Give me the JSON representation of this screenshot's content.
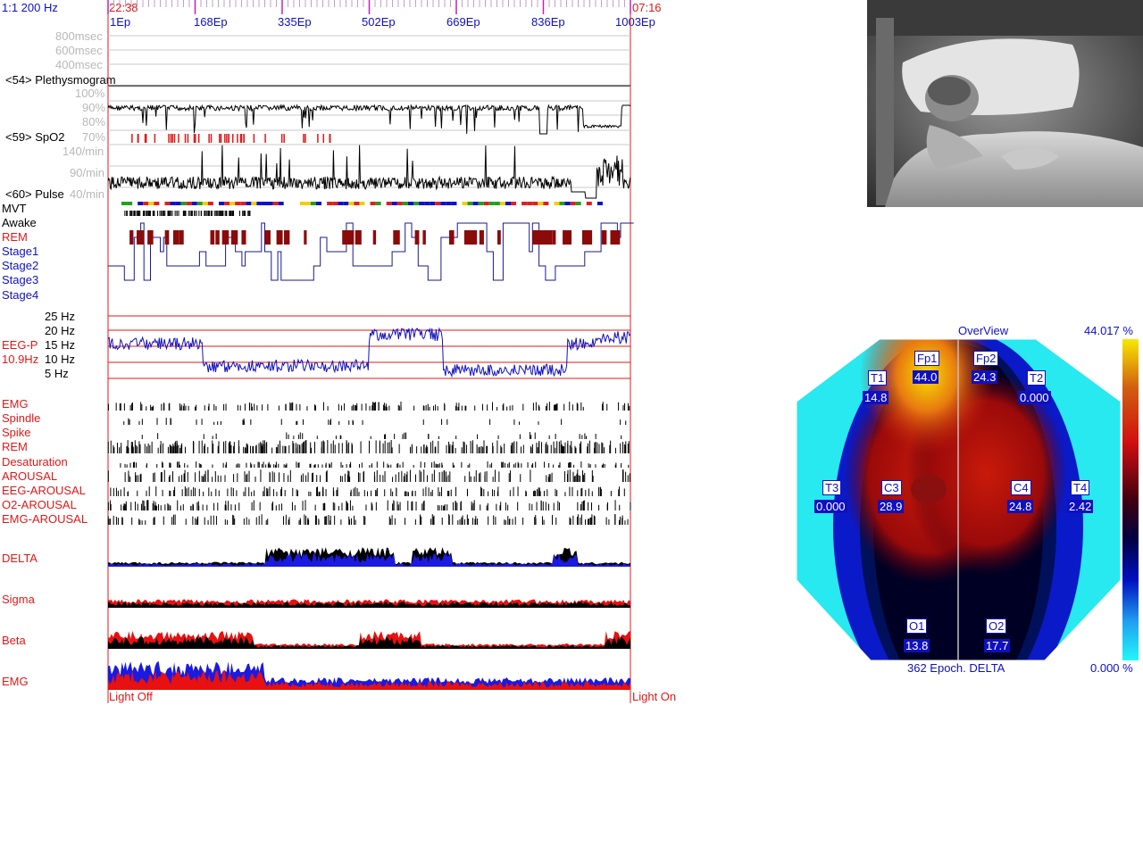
{
  "header": {
    "scale_label": "1:1 200 Hz",
    "start_time": "22:38",
    "end_time": "07:16",
    "epoch_ticks": [
      "1Ep",
      "168Ep",
      "335Ep",
      "502Ep",
      "669Ep",
      "836Ep",
      "1003Ep"
    ]
  },
  "channels": {
    "pleth_ticks": [
      "800msec",
      "600msec",
      "400msec"
    ],
    "pleth_label": "<54> Plethysmogram",
    "spo2_ticks": [
      "100%",
      "90%",
      "80%",
      "70%"
    ],
    "spo2_label": "<59> SpO2",
    "pulse_ticks": [
      "140/min",
      "90/min",
      "40/min"
    ],
    "pulse_label": "<60> Pulse",
    "mvt_label": "MVT",
    "stage_labels": [
      "Awake",
      "REM",
      "Stage1",
      "Stage2",
      "Stage3",
      "Stage4"
    ],
    "eeg_hz_ticks": [
      "25 Hz",
      "20 Hz",
      "15 Hz",
      "10 Hz",
      "5 Hz"
    ],
    "eeg_label": "EEG-P",
    "eeg_value": "10.9Hz",
    "event_labels": [
      "EMG",
      "Spindle",
      "Spike",
      "REM",
      "Desaturation",
      "AROUSAL",
      "EEG-AROUSAL",
      "O2-AROUSAL",
      "EMG-AROUSAL"
    ],
    "power_labels": [
      "DELTA",
      "Sigma",
      "Beta",
      "EMG"
    ],
    "light_off": "Light Off",
    "light_on": "Light On"
  },
  "topomap": {
    "title": "OverView",
    "max_label": "44.017 %",
    "min_label": "0.000 %",
    "footer": "362 Epoch. DELTA",
    "electrodes": [
      {
        "name": "Fp1",
        "value": "44.0"
      },
      {
        "name": "Fp2",
        "value": "24.3"
      },
      {
        "name": "T1",
        "value": "14.8"
      },
      {
        "name": "T2",
        "value": "0.000"
      },
      {
        "name": "T3",
        "value": "0.000"
      },
      {
        "name": "C3",
        "value": "28.9"
      },
      {
        "name": "C4",
        "value": "24.8"
      },
      {
        "name": "T4",
        "value": "2.42"
      },
      {
        "name": "O1",
        "value": "13.8"
      },
      {
        "name": "O2",
        "value": "17.7"
      }
    ]
  },
  "colors": {
    "axis_red": "#e01818",
    "label_blue": "#1010c0",
    "power_blue": "#1a1ae0",
    "power_red": "#e81010",
    "stage_line": "#1a1a90",
    "rem_fill": "#8b0a0a"
  },
  "chart_data": {
    "type": "line",
    "x_label": "Epoch",
    "x_range": [
      1,
      1003
    ],
    "spo2_percent_range": [
      70,
      100
    ],
    "pulse_per_min_range": [
      40,
      140
    ],
    "eeg_peak_hz_range": [
      5,
      25
    ],
    "hypnogram_stages": [
      "Awake",
      "REM",
      "Stage1",
      "Stage2",
      "Stage3",
      "Stage4"
    ],
    "topomap_delta_percent": {
      "Fp1": 44.0,
      "Fp2": 24.3,
      "T1": 14.8,
      "T2": 0.0,
      "T3": 0.0,
      "C3": 28.9,
      "C4": 24.8,
      "T4": 2.42,
      "O1": 13.8,
      "O2": 17.7
    }
  }
}
